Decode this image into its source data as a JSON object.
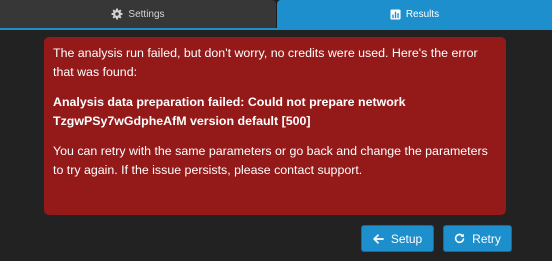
{
  "tabs": {
    "settings": {
      "label": "Settings",
      "icon": "gear-icon"
    },
    "results": {
      "label": "Results",
      "icon": "bar-chart-icon",
      "active": true
    }
  },
  "error": {
    "intro": "The analysis run failed, but don't worry, no credits were used. Here's the error that was found:",
    "detail": "Analysis data preparation failed: Could not prepare network TzgwPSy7wGdpheAfM version default [500]",
    "advice": "You can retry with the same parameters or go back and change the parameters to try again. If the issue persists, please contact support."
  },
  "actions": {
    "setup": {
      "label": "Setup",
      "icon": "arrow-left-icon"
    },
    "retry": {
      "label": "Retry",
      "icon": "refresh-icon"
    }
  },
  "colors": {
    "accent": "#1e8fcd",
    "error_background": "#941a1a",
    "page_background": "#222222"
  }
}
